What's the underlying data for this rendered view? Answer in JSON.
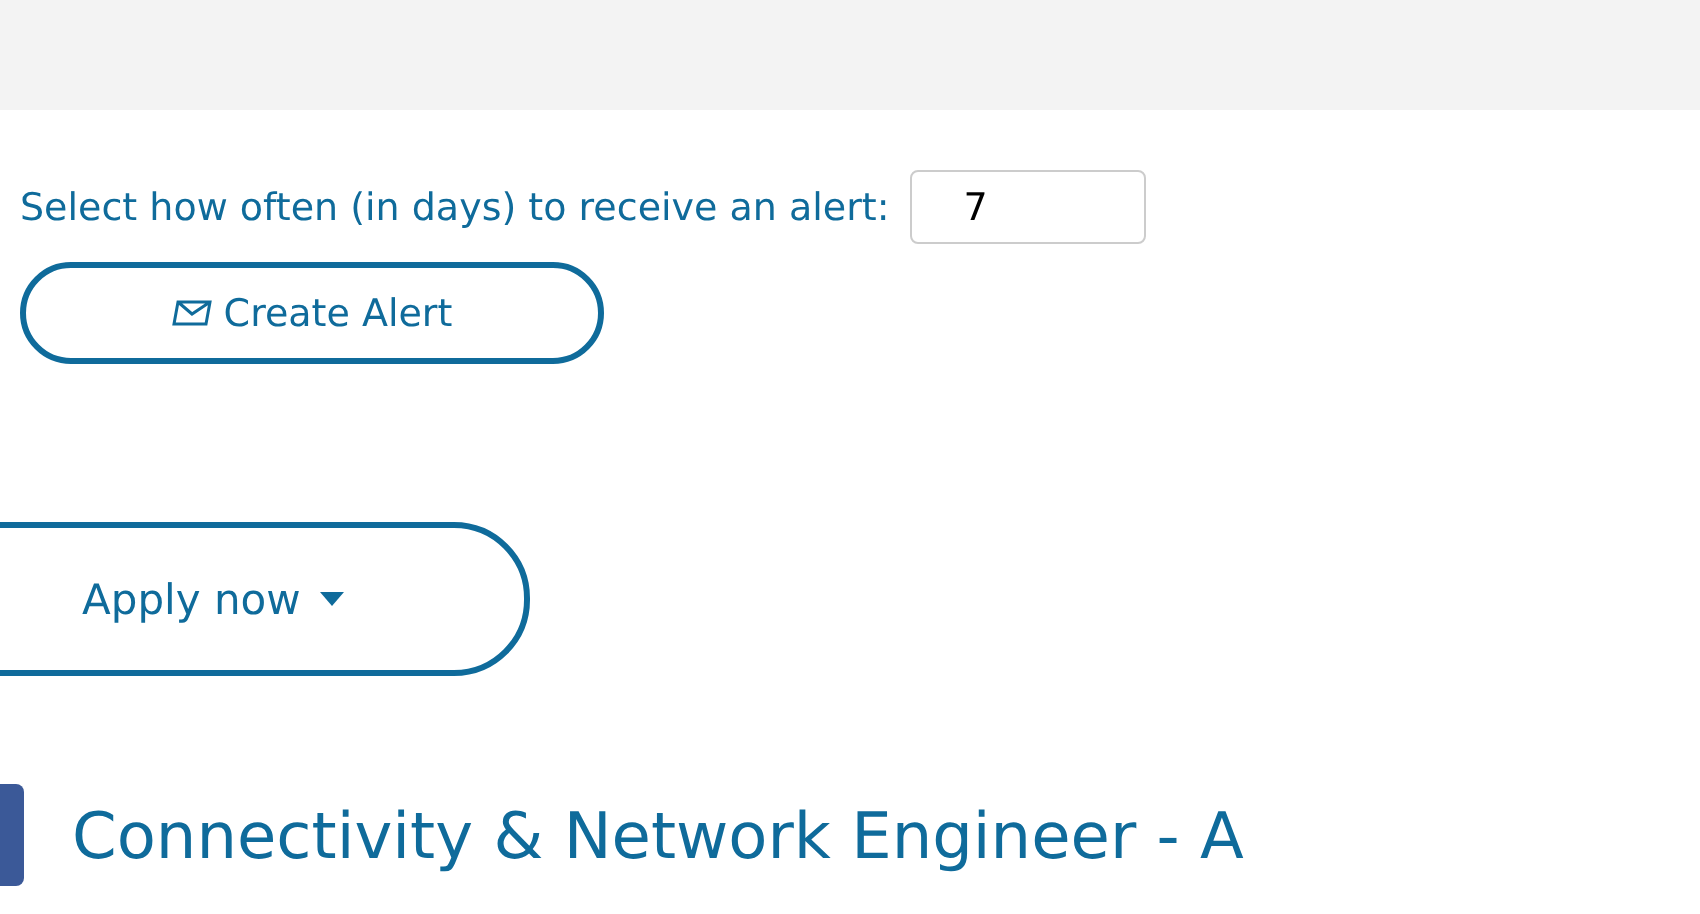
{
  "alert": {
    "label": "Select how often (in days) to receive an alert:",
    "days": "7",
    "button": "Create Alert"
  },
  "apply_button": "Apply now",
  "job_title": "Connectivity & Network Engineer - A"
}
